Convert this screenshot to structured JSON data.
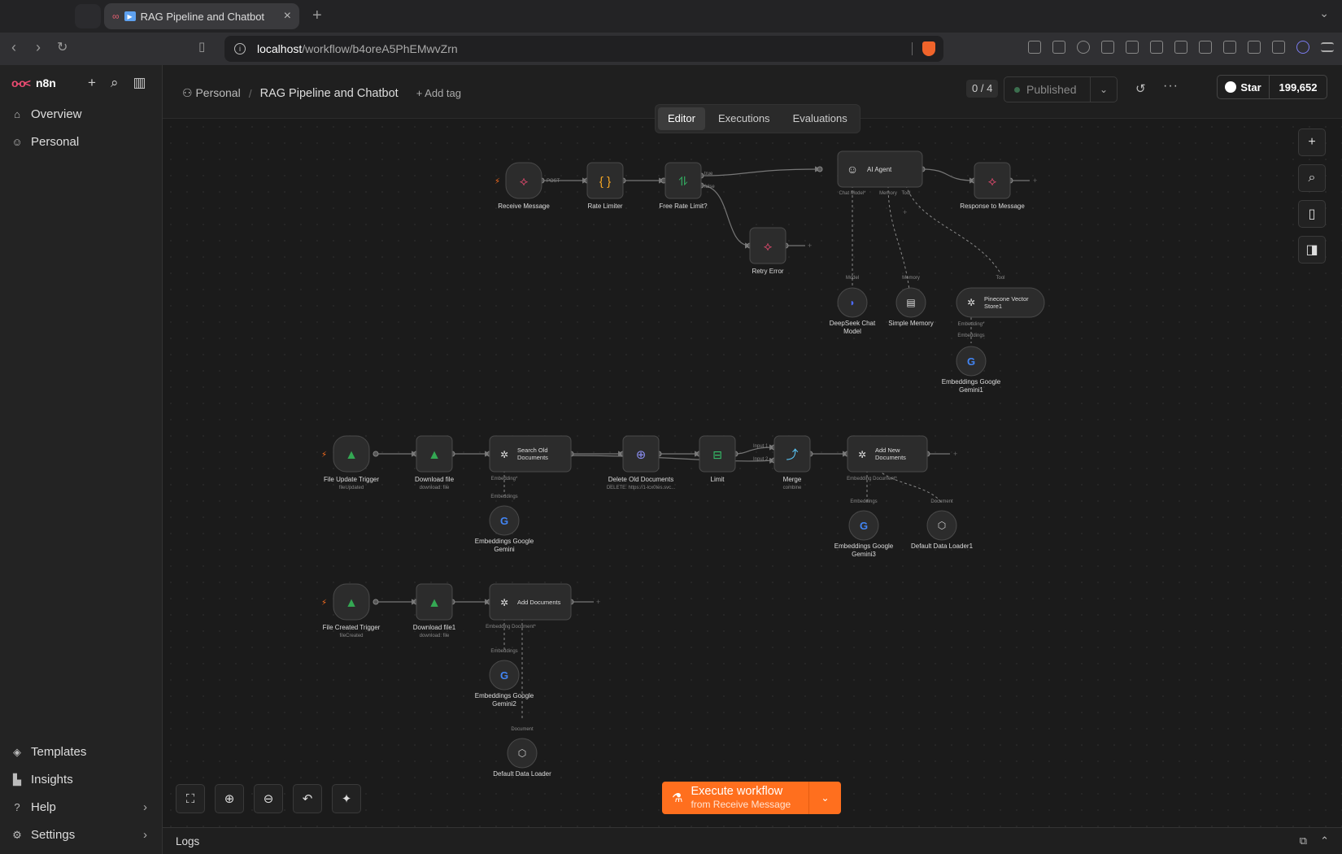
{
  "browser": {
    "tab_title": "RAG Pipeline and Chatbot",
    "url_host": "localhost",
    "url_path": "/workflow/b4oreA5PhEMwvZrn"
  },
  "sidebar": {
    "brand": "n8n",
    "items": [
      {
        "label": "Overview",
        "icon": "home-icon"
      },
      {
        "label": "Personal",
        "icon": "user-icon"
      }
    ],
    "bottom": [
      {
        "label": "Templates",
        "icon": "templates-icon"
      },
      {
        "label": "Insights",
        "icon": "chart-icon"
      },
      {
        "label": "Help",
        "icon": "help-icon"
      },
      {
        "label": "Settings",
        "icon": "gear-icon"
      }
    ]
  },
  "header": {
    "project": "Personal",
    "workflow_name": "RAG Pipeline and Chatbot",
    "add_tag": "+ Add tag",
    "counter": "0 / 4",
    "status": "Published",
    "github_label": "Star",
    "github_stars": "199,652"
  },
  "tabs": [
    {
      "label": "Editor",
      "active": true
    },
    {
      "label": "Executions",
      "active": false
    },
    {
      "label": "Evaluations",
      "active": false
    }
  ],
  "execute": {
    "label": "Execute workflow",
    "sub": "from Receive Message"
  },
  "logs_label": "Logs",
  "nodes": {
    "receive_message": "Receive Message",
    "rate_limiter": "Rate Limiter",
    "free_rate_limit": "Free Rate Limit?",
    "ai_agent": "AI Agent",
    "response_to_message": "Response to Message",
    "retry_error": "Retry Error",
    "deepseek_l1": "DeepSeek Chat",
    "deepseek_l2": "Model",
    "simple_memory": "Simple Memory",
    "pinecone_l1": "Pinecone Vector",
    "pinecone_l2": "Store1",
    "emb_g1_l1": "Embeddings Google",
    "emb_g1_l2": "Gemini1",
    "file_update_trigger": "File Update Trigger",
    "file_update_sub": "fileUpdated",
    "download_file": "Download file",
    "download_file_sub": "download: file",
    "search_old_l1": "Search Old",
    "search_old_l2": "Documents",
    "delete_old": "Delete Old Documents",
    "delete_old_sub": "DELETE: https://1-lcx0tes.svc...",
    "limit": "Limit",
    "merge": "Merge",
    "merge_sub": "combine",
    "add_new_l1": "Add New",
    "add_new_l2": "Documents",
    "emb_g_l1": "Embeddings Google",
    "emb_g_l2": "Gemini",
    "emb_g3_l1": "Embeddings Google",
    "emb_g3_l2": "Gemini3",
    "default_loader1": "Default Data Loader1",
    "file_created_trigger": "File Created Trigger",
    "file_created_sub": "fileCreated",
    "download_file1": "Download file1",
    "download_file1_sub": "download: file",
    "add_documents": "Add Documents",
    "emb_g2_l1": "Embeddings Google",
    "emb_g2_l2": "Gemini2",
    "default_loader": "Default Data Loader"
  },
  "ports": {
    "post": "POST",
    "true": "true",
    "false": "false",
    "chat_model": "Chat Model*",
    "memory": "Memory",
    "tool": "Tool",
    "model": "Model",
    "embedding_req": "Embedding*",
    "embeddings": "Embeddings",
    "input1": "Input 1",
    "input2": "Input 2",
    "embedding_document": "Embedding Document*",
    "document": "Document"
  }
}
